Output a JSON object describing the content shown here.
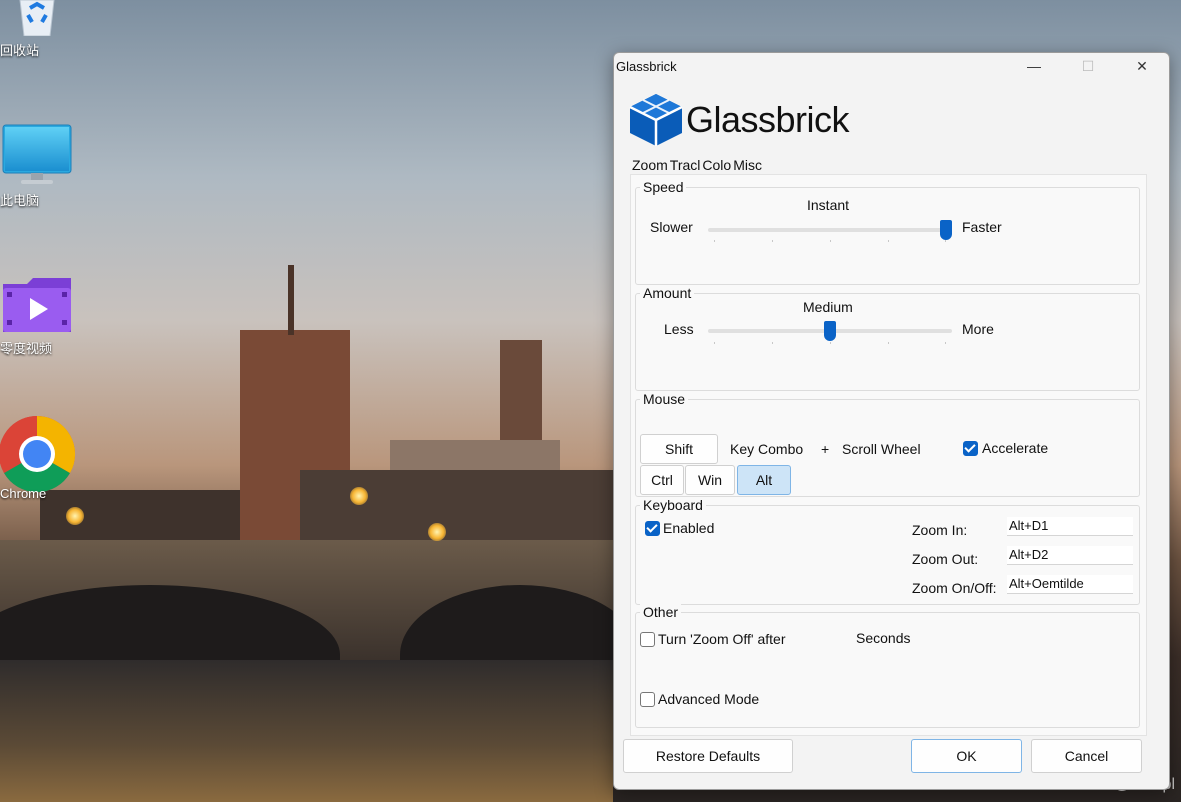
{
  "desktop": {
    "icons": [
      {
        "label": "回收站",
        "icon": "recycle-bin-icon"
      },
      {
        "label": "此电脑",
        "icon": "monitor-icon"
      },
      {
        "label": "零度视频",
        "icon": "video-player-icon"
      },
      {
        "label": "Chrome",
        "icon": "chrome-icon"
      }
    ],
    "watermark": "CSDN @discipl"
  },
  "window": {
    "title": "Glassbrick",
    "controls": {
      "minimize": "—",
      "maximize": "☐",
      "close": "✕"
    },
    "logo_text": "Glassbrick",
    "accent": "#0a63c7",
    "tabs": [
      "Zoom",
      "Tracl",
      "Colo",
      "Misc"
    ],
    "speed": {
      "title": "Speed",
      "value_label": "Instant",
      "min_label": "Slower",
      "max_label": "Faster",
      "level": 1.0
    },
    "amount": {
      "title": "Amount",
      "value_label": "Medium",
      "min_label": "Less",
      "max_label": "More",
      "level": 0.5
    },
    "mouse": {
      "title": "Mouse",
      "shift": "Shift",
      "ctrl": "Ctrl",
      "win": "Win",
      "alt": "Alt",
      "alt_selected": true,
      "key_combo": "Key Combo",
      "plus": "+",
      "scroll_wheel": "Scroll Wheel",
      "accelerate": "Accelerate",
      "accelerate_checked": true
    },
    "keyboard": {
      "title": "Keyboard",
      "enabled": "Enabled",
      "enabled_checked": true,
      "zoom_in_label": "Zoom In:",
      "zoom_in_value": "Alt+D1",
      "zoom_out_label": "Zoom Out:",
      "zoom_out_value": "Alt+D2",
      "zoom_onoff_label": "Zoom On/Off:",
      "zoom_onoff_value": "Alt+Oemtilde"
    },
    "other": {
      "title": "Other",
      "turn_off": "Turn 'Zoom Off' after",
      "turn_off_checked": false,
      "seconds": "Seconds",
      "advanced": "Advanced Mode",
      "advanced_checked": false
    },
    "buttons": {
      "restore": "Restore Defaults",
      "ok": "OK",
      "cancel": "Cancel"
    }
  }
}
